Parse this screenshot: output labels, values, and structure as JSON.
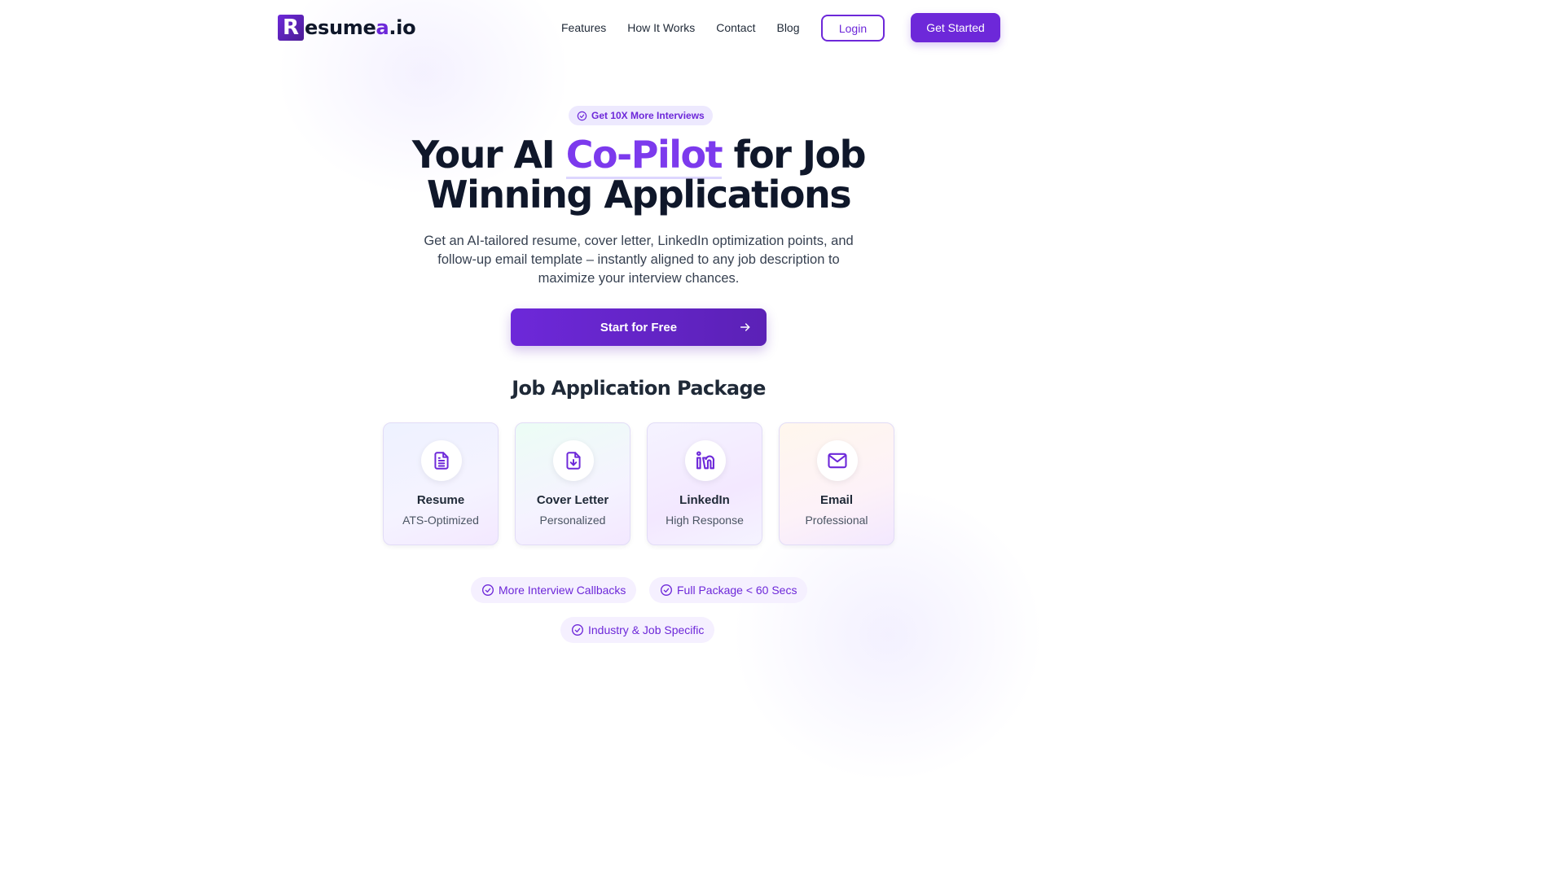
{
  "brand": {
    "logo_mark": "R",
    "logo_text": "esume",
    "logo_accent": "a",
    "logo_suffix": ".io"
  },
  "nav": {
    "links": [
      "Features",
      "How It Works",
      "Contact",
      "Blog"
    ],
    "login_label": "Login",
    "get_started_label": "Get Started"
  },
  "hero": {
    "badge": "Get 10X More Interviews",
    "title_part1": "Your AI ",
    "title_accent": "Co-Pilot",
    "title_part2": " for Job",
    "title_line2": "Winning Applications",
    "subtitle": "Get an AI-tailored resume, cover letter, LinkedIn optimization points, and follow-up email template – instantly aligned to any job description to maximize your interview chances.",
    "cta_label": "Start for Free"
  },
  "package": {
    "title": "Job Application Package",
    "cards": [
      {
        "title": "Resume",
        "subtitle": "ATS-Optimized",
        "icon": "document-icon"
      },
      {
        "title": "Cover Letter",
        "subtitle": "Personalized",
        "icon": "file-download-icon"
      },
      {
        "title": "LinkedIn",
        "subtitle": "High Response",
        "icon": "linkedin-icon"
      },
      {
        "title": "Email",
        "subtitle": "Professional",
        "icon": "mail-icon"
      }
    ]
  },
  "features": [
    "More Interview Callbacks",
    "Full Package < 60 Secs",
    "Industry & Job Specific"
  ],
  "colors": {
    "accent": "#6d28d9",
    "accent_light": "#7c3aed",
    "badge_bg": "#ede9fe",
    "text_dark": "#0f172a"
  }
}
